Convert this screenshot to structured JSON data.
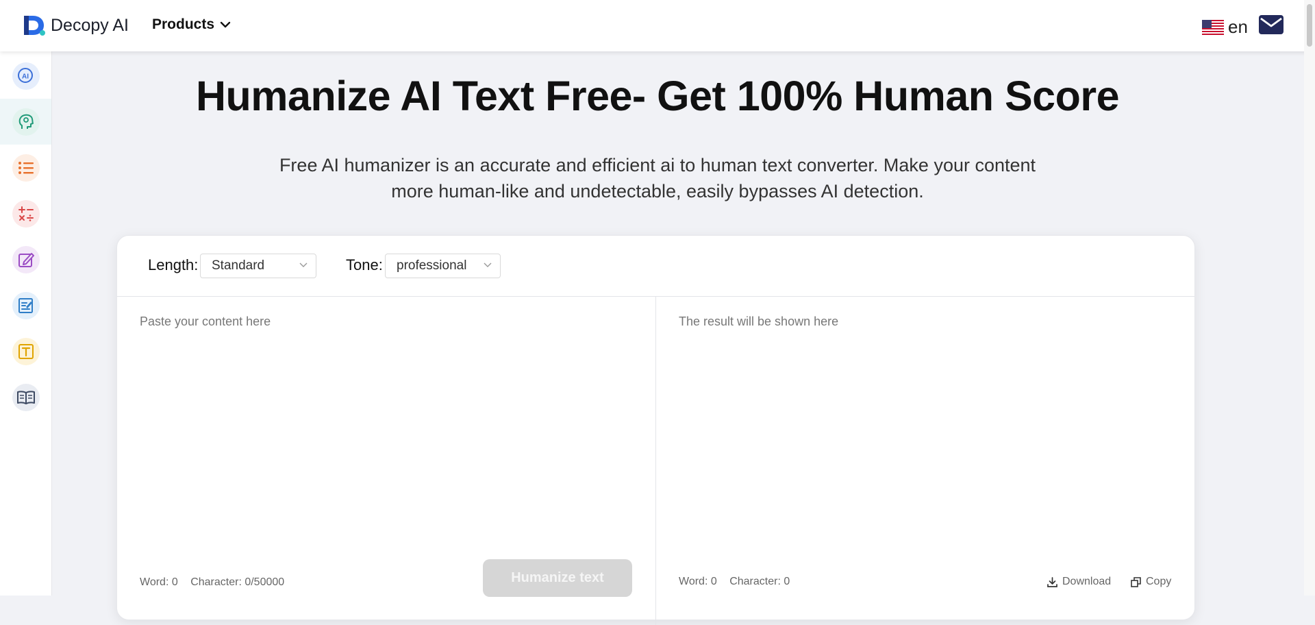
{
  "header": {
    "logo_text": "Decopy AI",
    "products_label": "Products",
    "language": "en",
    "icons": [
      "decopy-logo-icon",
      "chevron-down-icon",
      "us-flag-icon",
      "mail-icon"
    ]
  },
  "sidebar": {
    "items": [
      {
        "name": "ai-detector",
        "icon": "ai-detect-icon",
        "active": false
      },
      {
        "name": "ai-humanizer",
        "icon": "head-brain-icon",
        "active": true
      },
      {
        "name": "list-tool",
        "icon": "list-icon",
        "active": false
      },
      {
        "name": "math-solver",
        "icon": "math-symbols-icon",
        "active": false
      },
      {
        "name": "writer",
        "icon": "edit-icon",
        "active": false
      },
      {
        "name": "essay-checker",
        "icon": "note-edit-icon",
        "active": false
      },
      {
        "name": "text-tool",
        "icon": "text-box-icon",
        "active": false
      },
      {
        "name": "reader",
        "icon": "book-icon",
        "active": false
      }
    ]
  },
  "main": {
    "title": "Humanize AI Text Free- Get 100% Human Score",
    "subtitle": "Free AI humanizer is an accurate and efficient ai to human text converter. Make your content more human-like and undetectable, easily bypasses AI detection."
  },
  "options": {
    "length_label": "Length:",
    "length_value": "Standard",
    "tone_label": "Tone:",
    "tone_value": "professional"
  },
  "input_pane": {
    "placeholder": "Paste your content here",
    "word_count": "Word: 0",
    "char_count": "Character: 0/50000",
    "button_label": "Humanize text"
  },
  "output_pane": {
    "placeholder": "The result will be shown here",
    "word_count": "Word: 0",
    "char_count": "Character: 0",
    "download_label": "Download",
    "copy_label": "Copy"
  },
  "colors": {
    "page_bg": "#f1f2f6",
    "button_disabled": "#d6d6d6",
    "active_sidebar_bg": "#eef6f8"
  }
}
